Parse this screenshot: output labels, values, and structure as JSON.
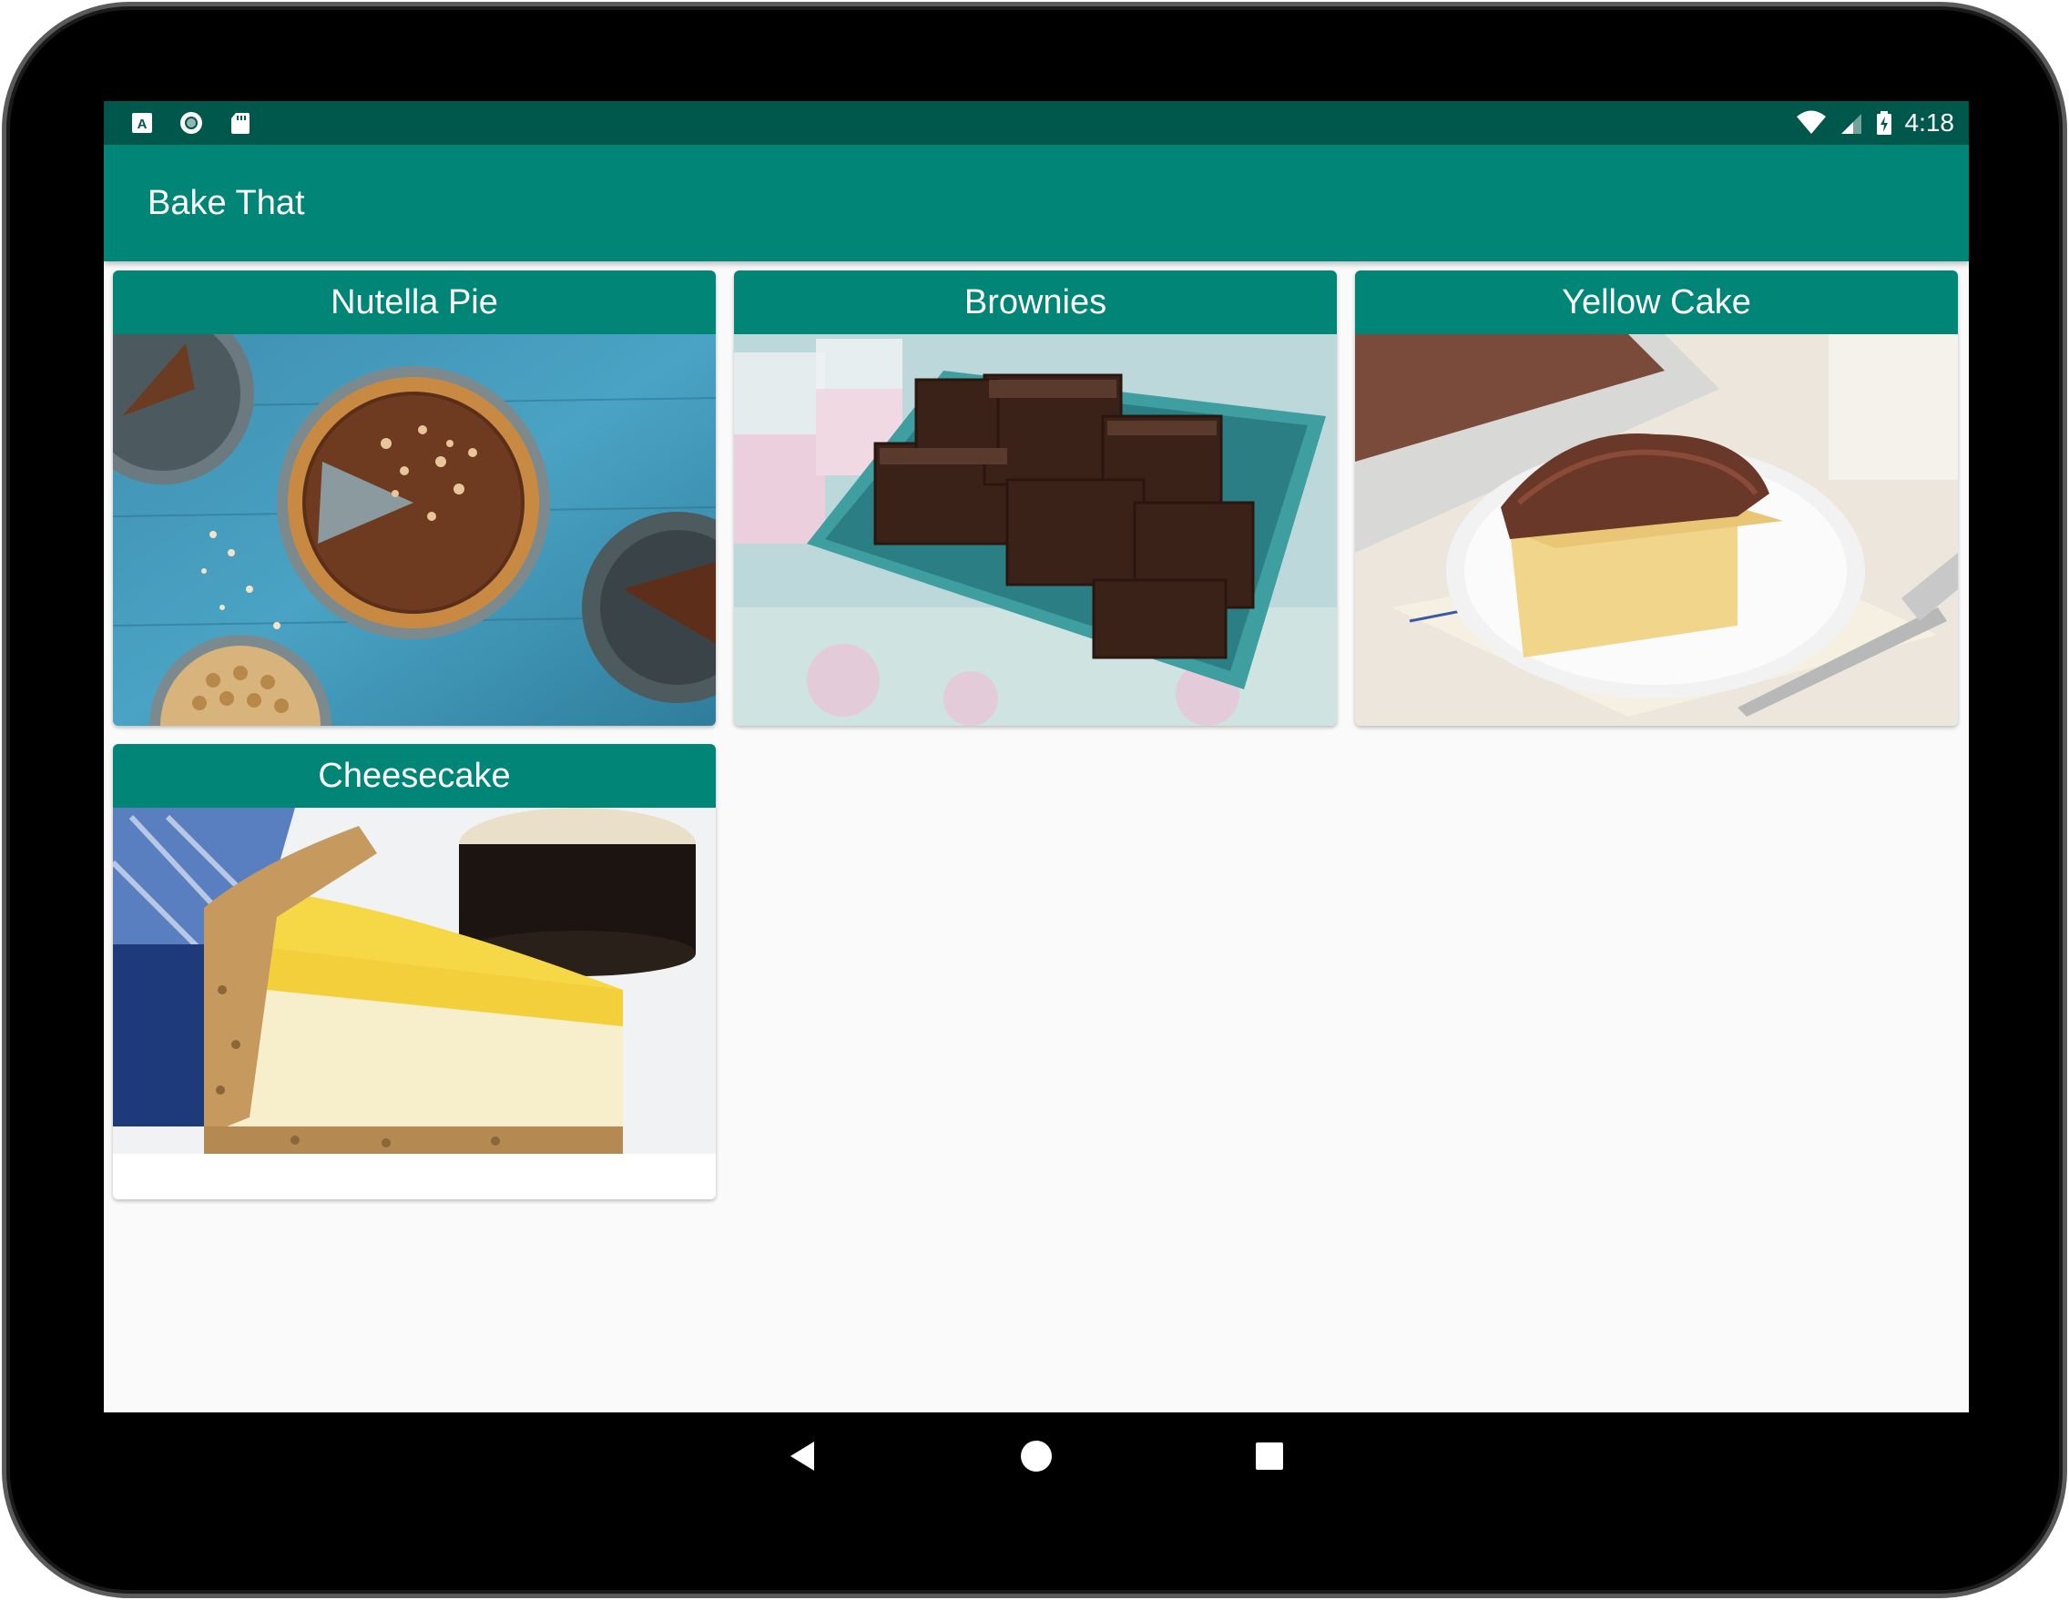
{
  "status_bar": {
    "time": "4:18",
    "icons_left": [
      "accessibility-a-icon",
      "record-circle-icon",
      "sd-card-icon"
    ],
    "icons_right": [
      "wifi-icon",
      "cell-signal-icon",
      "battery-charging-icon"
    ]
  },
  "app_bar": {
    "title": "Bake That"
  },
  "recipes": [
    {
      "name": "Nutella Pie"
    },
    {
      "name": "Brownies"
    },
    {
      "name": "Yellow Cake"
    },
    {
      "name": "Cheesecake"
    }
  ],
  "nav_bar": {
    "buttons": [
      "back-icon",
      "home-icon",
      "recents-icon"
    ]
  },
  "colors": {
    "status_bar": "#00574b",
    "primary": "#008577",
    "background": "#fafafa"
  }
}
